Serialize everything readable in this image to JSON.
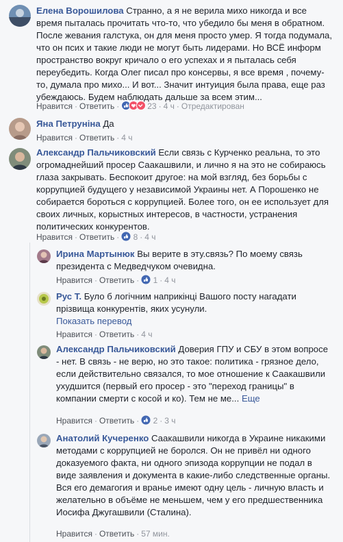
{
  "colors": {
    "name": "#385898",
    "meta": "#90949c",
    "bg": "#f6f7f9",
    "like": "#4267b2",
    "love": "#f25268"
  },
  "comments": [
    {
      "name": "Елена Ворошилова",
      "text": "Странно, а я не верила михо никогда и все время пыталась прочитать что-то, что убедило бы меня в обратном. После жевания галстука, он для меня просто умер. Я тогда подумала, что он псих и такие люди не могут быть лидерами. Но ВСЁ информ пространство вокруг кричало о его успехах и я пыталась себя переубедить. Когда Олег писал про консервы, я все время , почему-то, думала про михо... И вот... Значит интуиция была права, еще раз убеждаюсь. Будем наблюдать дальше за всем этим...",
      "like": "Нравится",
      "reply": "Ответить",
      "reactions": "23",
      "time": "4 ч",
      "edited": "Отредактирован"
    },
    {
      "name": "Яна Петруніна",
      "text": "Да",
      "like": "Нравится",
      "reply": "Ответить",
      "time": "4 ч"
    },
    {
      "name": "Александр Пальчиковский",
      "text": "Если связь с Курченко реальна, то это огромаднейший просер Саакашвили, и лично я на это не собираюсь глаза закрывать. Беспокоит другое: на мой взгляд, без борьбы с коррупцией будущего у независимой Украины нет. А Порошенко не собирается бороться с коррупцией. Более того, он ее использует для своих личных, корыстных интересов, в частности, устранения политических конкурентов.",
      "like": "Нравится",
      "reply": "Ответить",
      "reactions": "8",
      "time": "4 ч"
    }
  ],
  "replies": [
    {
      "name": "Ирина Мартынюк",
      "text": "Вы верите в эту.связь? По моему связь президента с Медведчуком очевидна.",
      "like": "Нравится",
      "reply": "Ответить",
      "reactions": "1",
      "time": "4 ч"
    },
    {
      "name": "Рус Т.",
      "text": "Було б логічним наприкінці Вашого посту нагадати прізвища конкурентів, яких усунули.",
      "translate": "Показать перевод",
      "like": "Нравится",
      "reply": "Ответить",
      "time": "4 ч"
    },
    {
      "name": "Александр Пальчиковский",
      "text": "Доверия ГПУ и СБУ в этом вопросе - нет. В связь - не верю, но это такое: политика - грязное дело, если действительно связался, то мое отношение к Саакашвили ухудшится (первый его просер - это \"переход границы\" в компании смерти с косой и ко). Тем не ме...",
      "more": "Еще",
      "like": "Нравится",
      "reply": "Ответить",
      "reactions": "2",
      "time": "3 ч"
    },
    {
      "name": "Анатолий Кучеренко",
      "text": "Саакашвили никогда в Украине никакими методами с коррупцией не боролся. Он не привёл ни одного доказуемого факта, ни одного эпизода коррупции не подал в виде заявления и документа в какие-либо следственные органы. Вся его демагогия и вранье имеют одну цель - личную власть и желательно в объёме не меньшем, чем у его предшественника Иосифа Джугашвили (Сталина).",
      "like": "Нравится",
      "reply": "Ответить",
      "time": "57 мин."
    }
  ]
}
